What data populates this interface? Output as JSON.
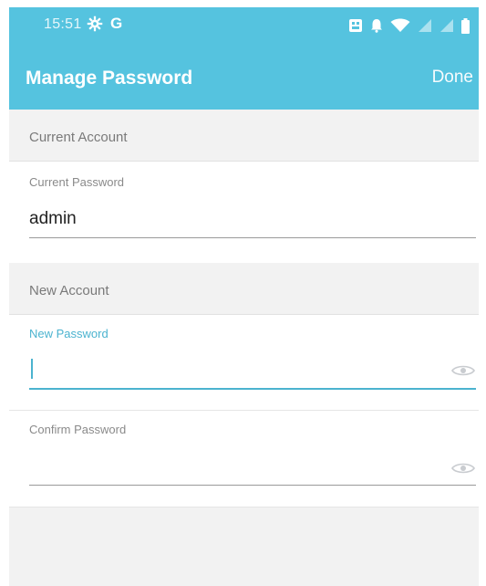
{
  "status_bar": {
    "time": "15:51",
    "icons": [
      "gear-icon",
      "google-g-icon",
      "notification-box-icon",
      "bell-icon",
      "wifi-icon",
      "signal-icon",
      "battery-icon"
    ],
    "google_letter": "G"
  },
  "app_bar": {
    "title": "Manage Password",
    "done_label": "Done",
    "color": "#55c3df"
  },
  "sections": {
    "current": {
      "header": "Current Account",
      "field_label": "Current Password",
      "value": "admin"
    },
    "new": {
      "header": "New Account",
      "new_password_label": "New Password",
      "new_password_value": "",
      "confirm_password_label": "Confirm Password",
      "confirm_password_value": ""
    }
  },
  "accent": "#4bb3cf"
}
